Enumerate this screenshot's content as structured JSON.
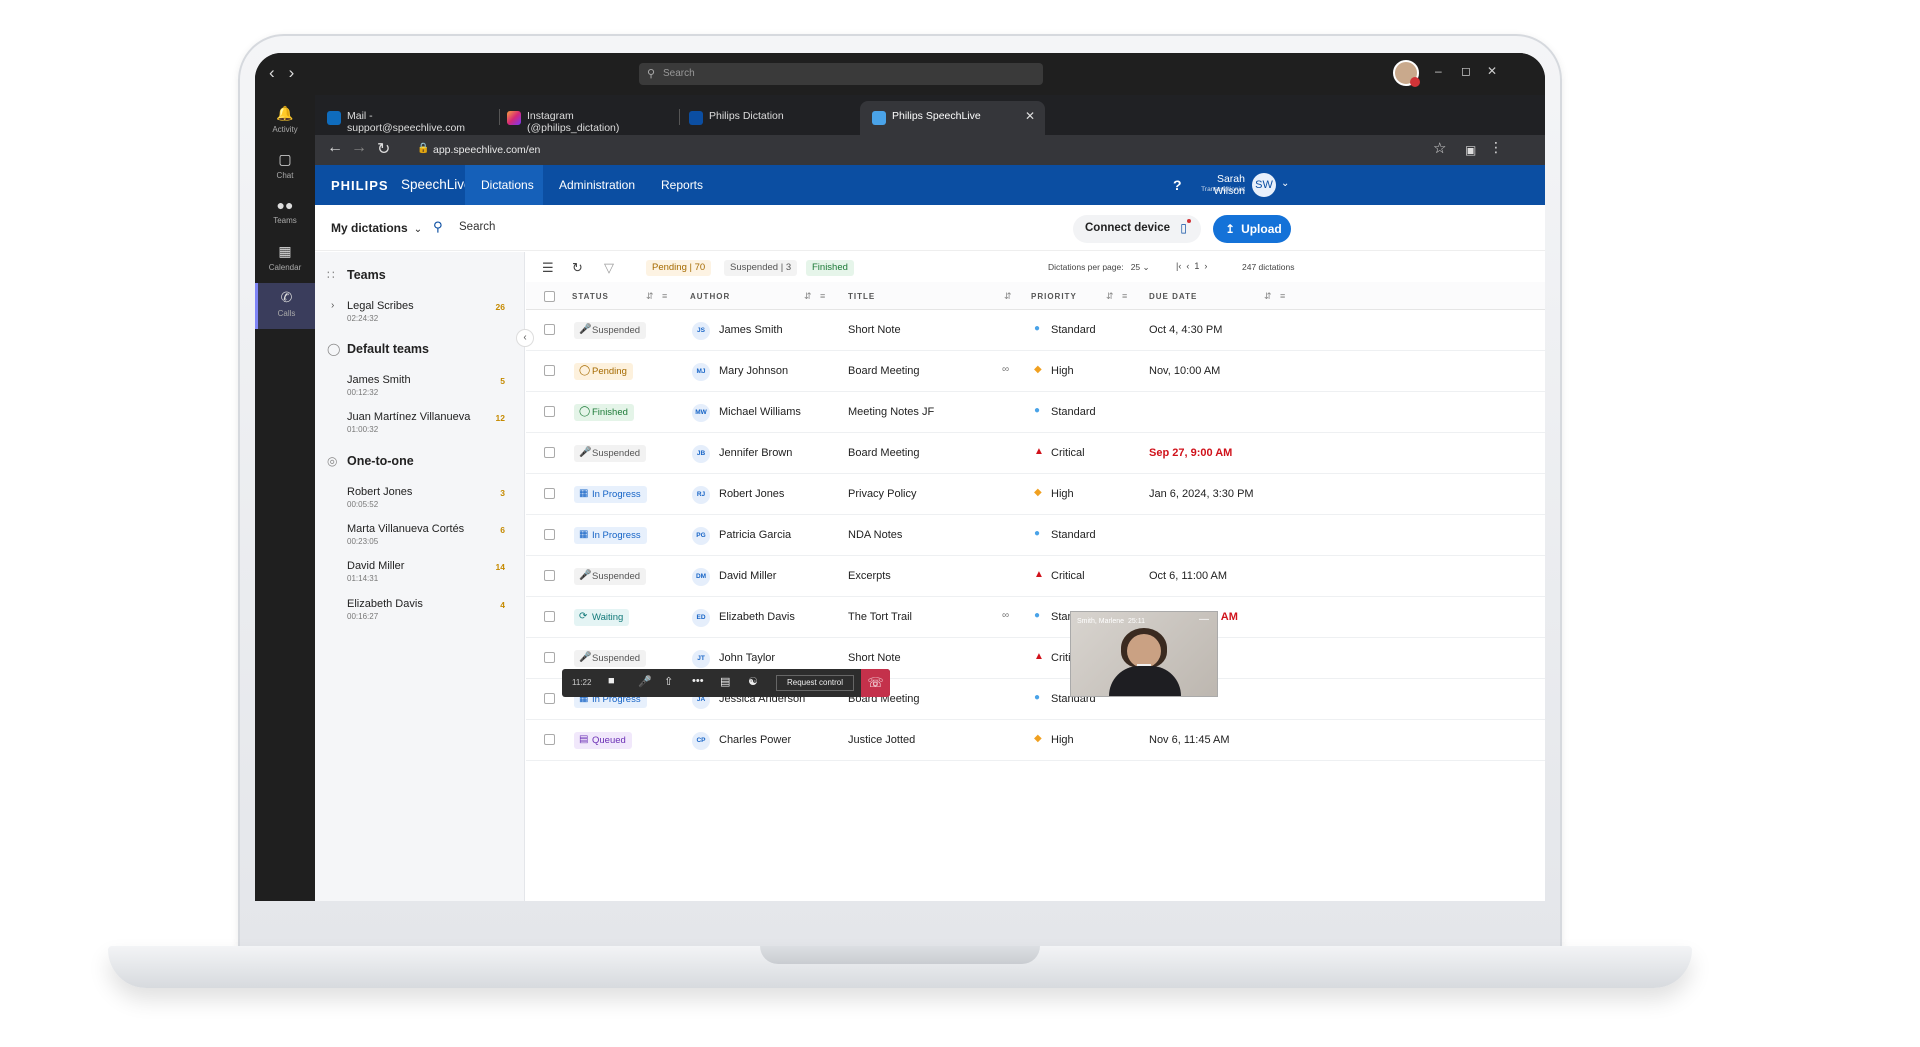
{
  "teams": {
    "search_placeholder": "Search",
    "rail": [
      {
        "label": "Activity",
        "icon": "bell-icon"
      },
      {
        "label": "Chat",
        "icon": "chat-icon"
      },
      {
        "label": "Teams",
        "icon": "teams-icon"
      },
      {
        "label": "Calendar",
        "icon": "calendar-icon"
      },
      {
        "label": "Calls",
        "icon": "phone-icon"
      }
    ]
  },
  "browser": {
    "tabs": [
      {
        "label": "Mail - support@speechlive.com"
      },
      {
        "label": "Instagram (@philips_dictation)"
      },
      {
        "label": "Philips Dictation"
      },
      {
        "label": "Philips SpeechLive"
      }
    ],
    "url": "app.speechlive.com/en"
  },
  "app": {
    "brand": "PHILIPS",
    "product": "SpeechLive",
    "nav": [
      "Dictations",
      "Administration",
      "Reports"
    ],
    "help": "?",
    "user_name": "Sarah Wilson",
    "user_role": "Transcriptionist",
    "user_initials": "SW",
    "my_dictations": "My dictations",
    "search": "Search",
    "connect_device": "Connect device",
    "upload": "Upload",
    "accent": "#0b4ea2"
  },
  "sidebar": {
    "teams_header": "Teams",
    "teams": [
      {
        "name": "Legal Scribes",
        "time": "02:24:32",
        "count": "26"
      }
    ],
    "default_header": "Default teams",
    "default": [
      {
        "name": "James Smith",
        "time": "00:12:32",
        "count": "5"
      },
      {
        "name": "Juan Martínez Villanueva",
        "time": "01:00:32",
        "count": "12"
      }
    ],
    "one_header": "One-to-one",
    "one": [
      {
        "name": "Robert Jones",
        "time": "00:05:52",
        "count": "3"
      },
      {
        "name": "Marta Villanueva Cortés",
        "time": "00:23:05",
        "count": "6"
      },
      {
        "name": "David Miller",
        "time": "01:14:31",
        "count": "14"
      },
      {
        "name": "Elizabeth Davis",
        "time": "00:16:27",
        "count": "4"
      }
    ]
  },
  "filters": {
    "pending": "Pending | 70",
    "suspended": "Suspended | 3",
    "finished": "Finished",
    "per_page_label": "Dictations per page:",
    "per_page": "25",
    "page": "1",
    "total": "247 dictations"
  },
  "columns": {
    "status": "STATUS",
    "author": "AUTHOR",
    "title": "TITLE",
    "priority": "PRIORITY",
    "due": "DUE DATE"
  },
  "rows": [
    {
      "status": "Suspended",
      "st": "suspended",
      "initials": "JS",
      "author": "James Smith",
      "title": "Short Note",
      "clip": false,
      "priority": "Standard",
      "due": "Oct 4, 4:30 PM",
      "due_red": false
    },
    {
      "status": "Pending",
      "st": "pending",
      "initials": "MJ",
      "author": "Mary Johnson",
      "title": "Board Meeting",
      "clip": true,
      "priority": "High",
      "due": "Nov, 10:00 AM",
      "due_red": false
    },
    {
      "status": "Finished",
      "st": "finished",
      "initials": "MW",
      "author": "Michael Williams",
      "title": "Meeting Notes JF",
      "clip": false,
      "priority": "Standard",
      "due": "",
      "due_red": false
    },
    {
      "status": "Suspended",
      "st": "suspended",
      "initials": "JB",
      "author": "Jennifer Brown",
      "title": "Board Meeting",
      "clip": false,
      "priority": "Critical",
      "due": "Sep 27, 9:00 AM",
      "due_red": true
    },
    {
      "status": "In Progress",
      "st": "inprogress",
      "initials": "RJ",
      "author": "Robert Jones",
      "title": "Privacy Policy",
      "clip": false,
      "priority": "High",
      "due": "Jan 6, 2024, 3:30 PM",
      "due_red": false
    },
    {
      "status": "In Progress",
      "st": "inprogress",
      "initials": "PG",
      "author": "Patricia Garcia",
      "title": "NDA Notes",
      "clip": false,
      "priority": "Standard",
      "due": "",
      "due_red": false
    },
    {
      "status": "Suspended",
      "st": "suspended",
      "initials": "DM",
      "author": "David Miller",
      "title": "Excerpts",
      "clip": false,
      "priority": "Critical",
      "due": "Oct 6, 11:00 AM",
      "due_red": false
    },
    {
      "status": "Waiting",
      "st": "waiting",
      "initials": "ED",
      "author": "Elizabeth Davis",
      "title": "The Tort Trail",
      "clip": true,
      "priority": "Standard",
      "due": "Sep 28, 11:30 AM",
      "due_red": true
    },
    {
      "status": "Suspended",
      "st": "suspended",
      "initials": "JT",
      "author": "John Taylor",
      "title": "Short Note",
      "clip": false,
      "priority": "Critical",
      "due": "",
      "due_red": false
    },
    {
      "status": "In Progress",
      "st": "inprogress",
      "initials": "JA",
      "author": "Jessica Anderson",
      "title": "Board Meeting",
      "clip": false,
      "priority": "Standard",
      "due": "",
      "due_red": false
    },
    {
      "status": "Queued",
      "st": "queued",
      "initials": "CP",
      "author": "Charles Power",
      "title": "Justice Jotted",
      "clip": false,
      "priority": "High",
      "due": "Nov 6, 11:45 AM",
      "due_red": false
    }
  ],
  "priority_colors": {
    "Standard": "#4aa3e8",
    "High": "#f0a020",
    "Critical": "#d0121b"
  },
  "call": {
    "time": "11:22",
    "request_control": "Request control",
    "video_name": "Smith, Marlene",
    "video_time": "25:11"
  }
}
